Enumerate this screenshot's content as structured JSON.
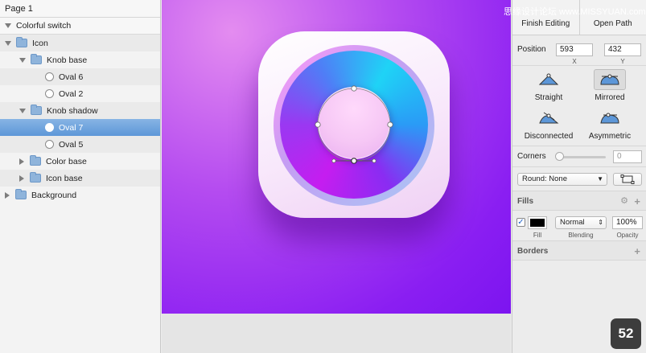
{
  "layers": {
    "page": "Page 1",
    "artboard": "Colorful switch",
    "items": [
      {
        "label": "Icon",
        "kind": "folder",
        "depth": 0,
        "expanded": true
      },
      {
        "label": "Knob base",
        "kind": "folder",
        "depth": 1,
        "expanded": true
      },
      {
        "label": "Oval 6",
        "kind": "oval",
        "depth": 2
      },
      {
        "label": "Oval 2",
        "kind": "oval",
        "depth": 2
      },
      {
        "label": "Knob shadow",
        "kind": "folder",
        "depth": 1,
        "expanded": true
      },
      {
        "label": "Oval 7",
        "kind": "oval",
        "depth": 2,
        "selected": true
      },
      {
        "label": "Oval 5",
        "kind": "oval",
        "depth": 2
      },
      {
        "label": "Color base",
        "kind": "folder",
        "depth": 1,
        "expanded": false
      },
      {
        "label": "Icon base",
        "kind": "folder",
        "depth": 1,
        "expanded": false
      },
      {
        "label": "Background",
        "kind": "folder",
        "depth": 0,
        "expanded": false
      }
    ]
  },
  "inspector": {
    "finish_editing": "Finish Editing",
    "open_path": "Open Path",
    "position_label": "Position",
    "x_value": "593",
    "y_value": "432",
    "x_label": "X",
    "y_label": "Y",
    "modes": {
      "straight": "Straight",
      "mirrored": "Mirrored",
      "disconnected": "Disconnected",
      "asymmetric": "Asymmetric"
    },
    "active_mode": "mirrored",
    "corners_label": "Corners",
    "corners_value": "0",
    "round_select": "Round: None",
    "fills_title": "Fills",
    "fill_label": "Fill",
    "fill_color": "#000000",
    "blending_value": "Normal",
    "blending_label": "Blending",
    "opacity_value": "100%",
    "opacity_label": "Opacity",
    "borders_title": "Borders",
    "fill_checked_mark": "✓",
    "plus_mark": "+"
  },
  "watermark": "思缘设计论坛 www.MISSYUAN.com",
  "badge": "52",
  "colors": {
    "selection": "#5d97d8",
    "accent_blue": "#6aa6e8",
    "artboard_purple": "#8a1ef2"
  }
}
